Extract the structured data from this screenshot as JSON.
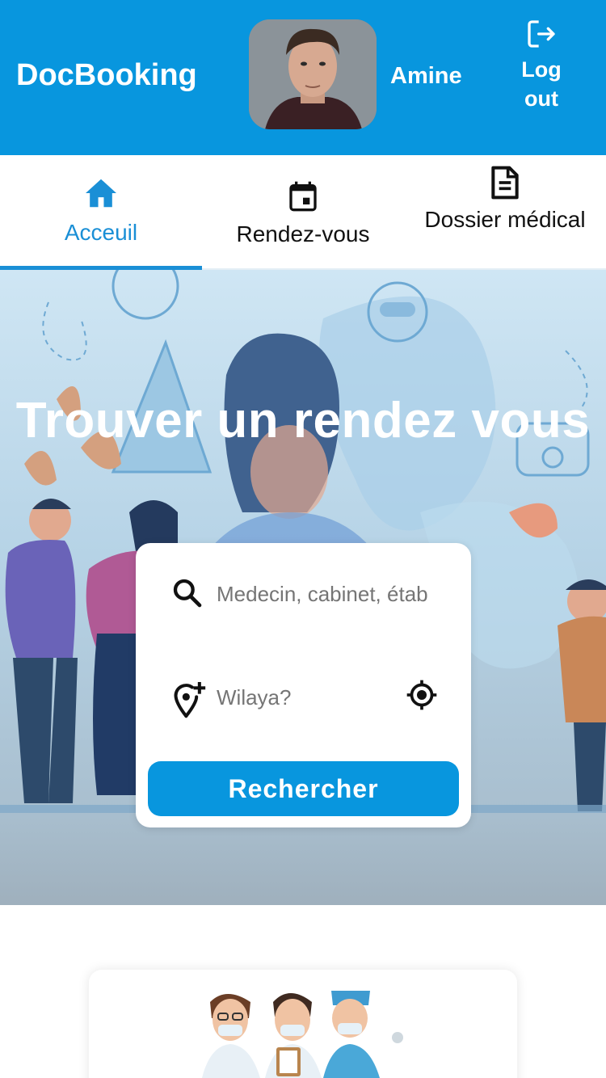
{
  "app": {
    "name": "DocBooking"
  },
  "user": {
    "name": "Amine"
  },
  "header": {
    "logout_label": "Log out"
  },
  "tabs": [
    {
      "label": "Acceuil",
      "icon": "home-icon",
      "active": true
    },
    {
      "label": "Rendez-vous",
      "icon": "calendar-icon",
      "active": false
    },
    {
      "label": "Dossier médical",
      "icon": "document-icon",
      "active": false
    }
  ],
  "hero": {
    "title": "Trouver un rendez vous"
  },
  "search": {
    "query_placeholder": "Medecin, cabinet, étab",
    "wilaya_placeholder": "Wilaya?",
    "button_label": "Rechercher"
  },
  "colors": {
    "primary": "#0896de",
    "active_tab": "#1a8fd6"
  }
}
